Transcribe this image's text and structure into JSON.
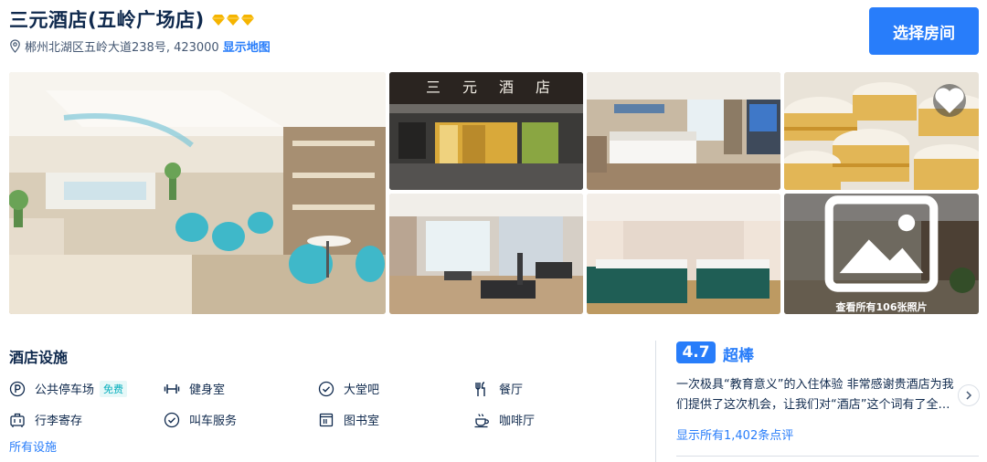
{
  "hotel": {
    "name": "三元酒店(五岭广场店)",
    "diamond_count": 3,
    "address": "郴州北湖区五岭大道238号, 423000",
    "map_link": "显示地图"
  },
  "header": {
    "choose_room_label": "选择房间"
  },
  "gallery": {
    "photos": [
      "lobby",
      "hotel-front",
      "guest-room",
      "dim-sum",
      "gym",
      "meeting-room",
      "more-photos"
    ],
    "more_photos_label": "查看所有106张照片"
  },
  "facilities": {
    "title": "酒店设施",
    "items": [
      {
        "label": "公共停车场",
        "icon": "parking-icon",
        "badge": "免费"
      },
      {
        "label": "健身室",
        "icon": "dumbbell-icon"
      },
      {
        "label": "大堂吧",
        "icon": "check-circle-icon"
      },
      {
        "label": "餐厅",
        "icon": "utensils-icon"
      },
      {
        "label": "行李寄存",
        "icon": "luggage-icon"
      },
      {
        "label": "叫车服务",
        "icon": "check-circle-icon"
      },
      {
        "label": "图书室",
        "icon": "library-icon"
      },
      {
        "label": "咖啡厅",
        "icon": "coffee-icon"
      }
    ],
    "all_link": "所有设施"
  },
  "reviews": {
    "score": "4.7",
    "score_word": "超棒",
    "excerpt": "一次极具“教育意义”的入住体验 非常感谢贵酒店为我们提供了这次机会，让我们对“酒店”这个词有了全新的认识",
    "all_link": "显示所有1,402条点评"
  },
  "colors": {
    "brand_blue": "#287dfa",
    "diamond_gold": "#f5b400",
    "text_dark": "#0f294d",
    "free_badge": "#06aebd"
  }
}
